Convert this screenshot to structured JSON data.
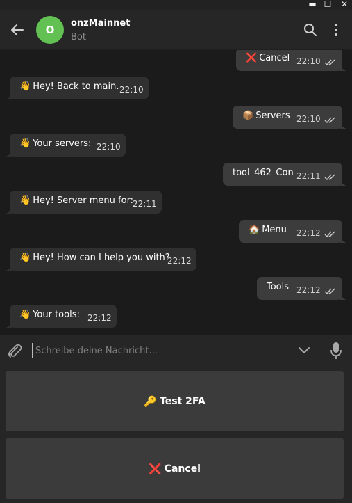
{
  "window": {
    "minimize_glyph": "▬",
    "maximize_glyph": "☐",
    "close_glyph": "✕"
  },
  "header": {
    "avatar_letter": "O",
    "avatar_color": "#63c154",
    "chat_name": "onzMainnet",
    "chat_status": "Bot"
  },
  "messages": [
    {
      "dir": "out",
      "emoji": "❌",
      "emoji_icon": "red-x-icon",
      "text": "Cancel",
      "time": "22:10"
    },
    {
      "dir": "in",
      "emoji": "👋",
      "emoji_icon": "waving-hand-icon",
      "text": "Hey! Back to main.",
      "time": "22:10"
    },
    {
      "dir": "out",
      "emoji": "📦",
      "emoji_icon": "package-icon",
      "text": "Servers",
      "time": "22:10"
    },
    {
      "dir": "in",
      "emoji": "👋",
      "emoji_icon": "waving-hand-icon",
      "text": "Your servers:",
      "time": "22:10"
    },
    {
      "dir": "out",
      "emoji": "",
      "emoji_icon": "",
      "text": "tool_462_Con",
      "time": "22:11"
    },
    {
      "dir": "in",
      "emoji": "👋",
      "emoji_icon": "waving-hand-icon",
      "text": "Hey! Server menu for:",
      "time": "22:11"
    },
    {
      "dir": "out",
      "emoji": "🏠",
      "emoji_icon": "house-icon",
      "text": "Menu",
      "time": "22:12"
    },
    {
      "dir": "in",
      "emoji": "👋",
      "emoji_icon": "waving-hand-icon",
      "text": "Hey! How can I help you with?",
      "time": "22:12"
    },
    {
      "dir": "out",
      "emoji": "",
      "emoji_icon": "",
      "text": "Tools",
      "time": "22:12"
    },
    {
      "dir": "in",
      "emoji": "👋",
      "emoji_icon": "waving-hand-icon",
      "text": "Your tools:",
      "time": "22:12"
    }
  ],
  "composer": {
    "placeholder": "Schreibe deine Nachricht...",
    "value": ""
  },
  "keyboard": {
    "buttons": [
      {
        "emoji": "🔑",
        "emoji_icon": "key-icon",
        "label": "Test 2FA"
      },
      {
        "emoji": "❌",
        "emoji_icon": "red-x-icon",
        "label": "Cancel"
      }
    ]
  },
  "colors": {
    "background": "#1b1b1b",
    "panel": "#262626",
    "bubble_out": "#3c3c3c",
    "bubble_in": "#303030",
    "button": "#3b3b3b",
    "placeholder": "#808080"
  }
}
